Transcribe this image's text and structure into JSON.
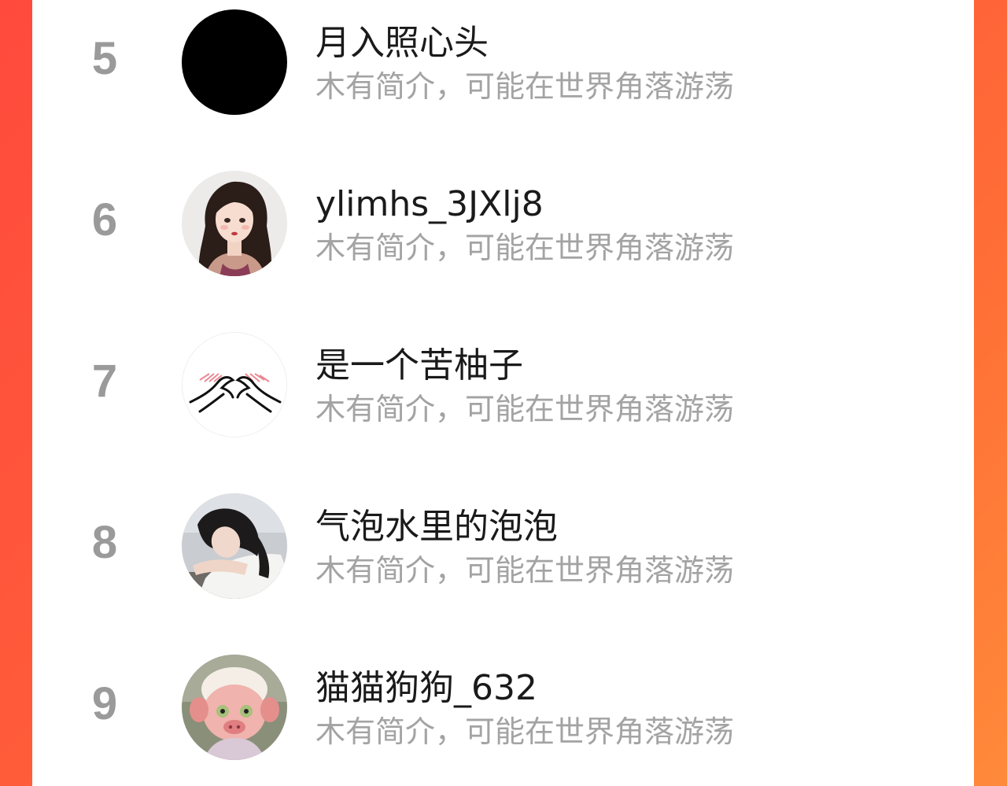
{
  "colors": {
    "background_gradient_start": "#ff4a3d",
    "background_gradient_end": "#ff8a3a",
    "card": "#ffffff",
    "rank_text": "#9a9a9a",
    "name_text": "#1a1a1a",
    "bio_text": "#a3a3a3"
  },
  "ranking": {
    "items": [
      {
        "rank": "5",
        "name": "月入照心头",
        "bio": "木有简介，可能在世界角落游荡",
        "avatar": "black-circle-avatar"
      },
      {
        "rank": "6",
        "name": "ylimhs_3JXlj8",
        "bio": "木有简介，可能在世界角落游荡",
        "avatar": "illustrated-girl-avatar"
      },
      {
        "rank": "7",
        "name": "是一个苦柚子",
        "bio": "木有简介，可能在世界角落游荡",
        "avatar": "heart-hands-sketch-avatar"
      },
      {
        "rank": "8",
        "name": "气泡水里的泡泡",
        "bio": "木有简介，可能在世界角落游荡",
        "avatar": "girl-leaning-photo-avatar"
      },
      {
        "rank": "9",
        "name": "猫猫狗狗_632",
        "bio": "木有简介，可能在世界角落游荡",
        "avatar": "pig-doll-photo-avatar"
      }
    ]
  }
}
